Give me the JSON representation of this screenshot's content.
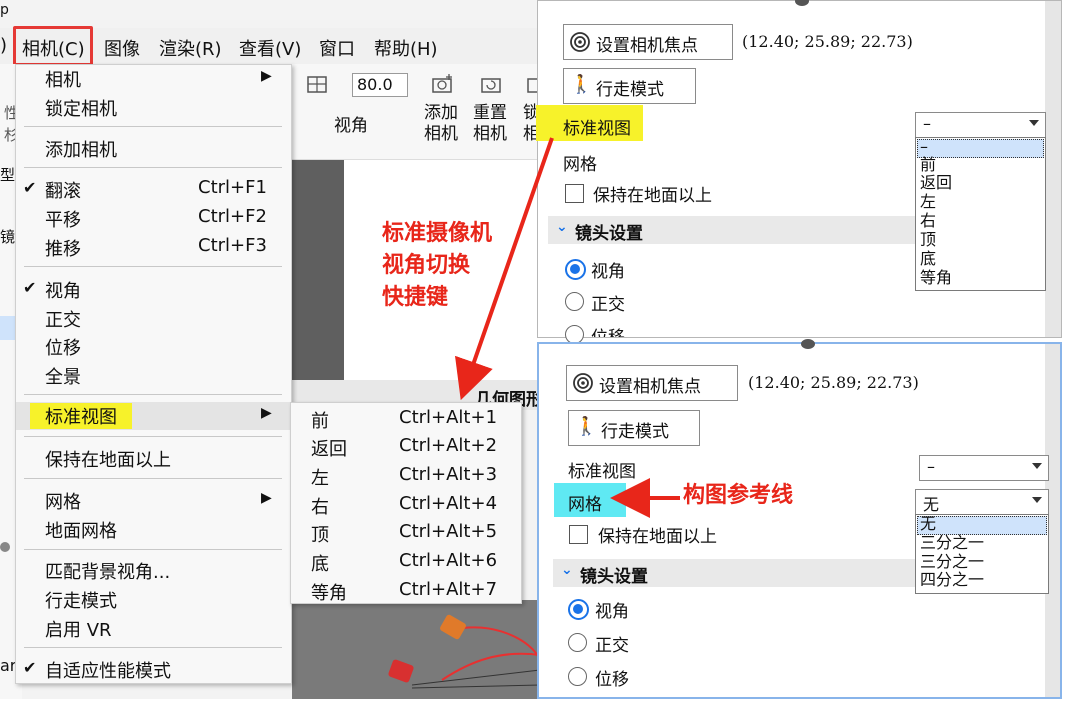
{
  "titlebar": {
    "fragment": "p"
  },
  "menubar": {
    "left_fragment": ")",
    "items": [
      "相机(C)",
      "图像",
      "渲染(R)",
      "查看(V)",
      "窗口",
      "帮助(H)"
    ]
  },
  "toolbar": {
    "fov_value": "80.0",
    "fov_label": "视角",
    "add_camera": [
      "添加",
      "相机"
    ],
    "reset_camera": [
      "重置",
      "相机"
    ],
    "lock_camera_fragment": [
      "锁",
      "相"
    ]
  },
  "left_fragments": {
    "a": "性",
    "b": "杉",
    "c": "型",
    "d": "镜",
    "e": "ar"
  },
  "geometry_tab": "几何图形",
  "camera_menu": {
    "items": [
      {
        "label": "相机",
        "check": "",
        "shortcut": "",
        "submenu": true
      },
      {
        "label": "锁定相机",
        "check": "",
        "shortcut": "",
        "submenu": false
      },
      {
        "label": "添加相机",
        "check": "",
        "shortcut": "",
        "submenu": false
      },
      {
        "label": "翻滚",
        "check": "✔",
        "shortcut": "Ctrl+F1",
        "submenu": false
      },
      {
        "label": "平移",
        "check": "",
        "shortcut": "Ctrl+F2",
        "submenu": false
      },
      {
        "label": "推移",
        "check": "",
        "shortcut": "Ctrl+F3",
        "submenu": false
      },
      {
        "label": "视角",
        "check": "✔",
        "shortcut": "",
        "submenu": false
      },
      {
        "label": "正交",
        "check": "",
        "shortcut": "",
        "submenu": false
      },
      {
        "label": "位移",
        "check": "",
        "shortcut": "",
        "submenu": false
      },
      {
        "label": "全景",
        "check": "",
        "shortcut": "",
        "submenu": false
      },
      {
        "label": "标准视图",
        "check": "",
        "shortcut": "",
        "submenu": true
      },
      {
        "label": "保持在地面以上",
        "check": "",
        "shortcut": "",
        "submenu": false
      },
      {
        "label": "网格",
        "check": "",
        "shortcut": "",
        "submenu": true
      },
      {
        "label": "地面网格",
        "check": "",
        "shortcut": "",
        "submenu": false
      },
      {
        "label": "匹配背景视角...",
        "check": "",
        "shortcut": "",
        "submenu": false
      },
      {
        "label": "行走模式",
        "check": "",
        "shortcut": "",
        "submenu": false
      },
      {
        "label": "启用 VR",
        "check": "",
        "shortcut": "",
        "submenu": false
      },
      {
        "label": "自适应性能模式",
        "check": "✔",
        "shortcut": "",
        "submenu": false
      }
    ]
  },
  "standard_view_submenu": {
    "items": [
      {
        "label": "前",
        "shortcut": "Ctrl+Alt+1"
      },
      {
        "label": "返回",
        "shortcut": "Ctrl+Alt+2"
      },
      {
        "label": "左",
        "shortcut": "Ctrl+Alt+3"
      },
      {
        "label": "右",
        "shortcut": "Ctrl+Alt+4"
      },
      {
        "label": "顶",
        "shortcut": "Ctrl+Alt+5"
      },
      {
        "label": "底",
        "shortcut": "Ctrl+Alt+6"
      },
      {
        "label": "等角",
        "shortcut": "Ctrl+Alt+7"
      }
    ]
  },
  "annotations": {
    "shortcut_note": [
      "标准摄像机",
      "视角切换",
      "快捷键"
    ],
    "grid_note": "构图参考线"
  },
  "panel_top": {
    "set_focus_button": "设置相机焦点",
    "coords": "(12.40; 25.89; 22.73)",
    "walk_mode_button": "行走模式",
    "standard_view_label": "标准视图",
    "standard_view_value": "–",
    "grid_label": "网格",
    "keep_above_ground": "保持在地面以上",
    "lens_section": "镜头设置",
    "radios": [
      "视角",
      "正交",
      "位移"
    ],
    "dropdown_options": [
      "–",
      "前",
      "返回",
      "左",
      "右",
      "顶",
      "底",
      "等角"
    ]
  },
  "panel_bottom": {
    "set_focus_button": "设置相机焦点",
    "coords": "(12.40; 25.89; 22.73)",
    "walk_mode_button": "行走模式",
    "standard_view_label": "标准视图",
    "standard_view_value": "–",
    "grid_label": "网格",
    "grid_value": "无",
    "keep_above_ground": "保持在地面以上",
    "lens_section": "镜头设置",
    "radios": [
      "视角",
      "正交",
      "位移"
    ],
    "dropdown_options": [
      "无",
      "三分之一",
      "三分之一",
      "四分之一"
    ]
  },
  "colors": {
    "annotation_red": "#e8261a",
    "highlight_yellow": "#f7f22a",
    "highlight_cyan": "#5fe9f3",
    "radio_blue": "#1a73e8"
  }
}
